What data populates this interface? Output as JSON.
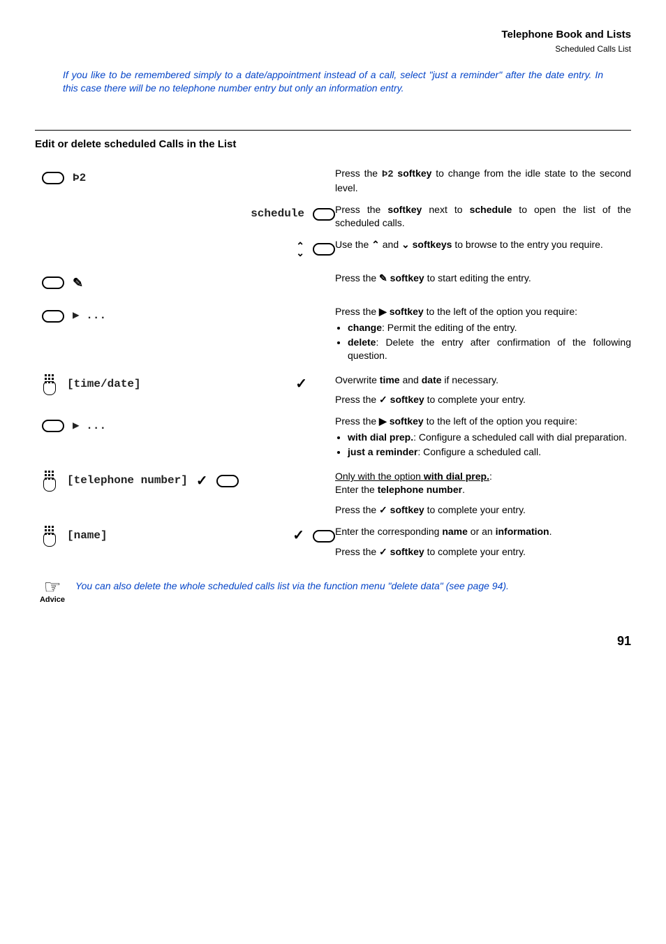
{
  "header": {
    "title": "Telephone Book and Lists",
    "subtitle": "Scheduled Calls List"
  },
  "intro": "If you like to be remembered simply to a date/appointment instead of a call, select \"just a reminder\" after the date entry. In this case there will be no telephone number entry but only an information entry.",
  "section_title": "Edit or delete scheduled Calls in the List",
  "steps": {
    "s1": {
      "lcd": "Þ2",
      "r_pre": "Press the ",
      "r_sym": "Þ2",
      "r_post1": " softkey",
      "r_post2": " to change from the idle state to the second level."
    },
    "s2": {
      "lcd": "schedule",
      "r1": "Press the ",
      "r2": "softkey",
      "r3": " next to ",
      "r4": "schedule",
      "r5": " to open the list of the scheduled calls."
    },
    "s3": {
      "r1": "Use the ",
      "r2": " and ",
      "r3": " softkeys",
      "r4": " to browse to the entry you require."
    },
    "s4": {
      "r1": "Press the ",
      "r2": " softkey",
      "r3": " to start editing the entry."
    },
    "s5": {
      "r1": "Press the ",
      "r_arrow": "▶",
      "r2": " softkey",
      "r3": " to the left of the option you require:",
      "li1a": "change",
      "li1b": ": Permit the editing of the entry.",
      "li2a": "delete",
      "li2b": ": Delete the entry after confirmation of the following question."
    },
    "s6": {
      "lcd": "[time/date]",
      "r1a": "Overwrite ",
      "r1b": "time",
      "r1c": " and ",
      "r1d": "date",
      "r1e": " if necessary.",
      "r2a": "Press the ",
      "r2b": " softkey",
      "r2c": " to complete your entry."
    },
    "s7": {
      "r1": "Press the ",
      "r_arrow": "▶",
      "r2": " softkey",
      "r3": " to the left of the option you require:",
      "li1a": "with dial prep.",
      "li1b": ": Configure a scheduled call with dial preparation.",
      "li2a": "just a reminder",
      "li2b": ": Configure a scheduled call."
    },
    "s8": {
      "lcd": "[telephone number]",
      "h1": "Only with the option ",
      "h2": "with dial prep.",
      "h3": ":",
      "r1a": "Enter the ",
      "r1b": "telephone number",
      "r1c": ".",
      "r2a": "Press the ",
      "r2b": " softkey",
      "r2c": " to complete your entry."
    },
    "s9": {
      "lcd": "[name]",
      "r1a": "Enter the corresponding ",
      "r1b": "name",
      "r1c": " or an ",
      "r1d": "information",
      "r1e": ".",
      "r2a": "Press the ",
      "r2b": " softkey",
      "r2c": " to complete your entry."
    }
  },
  "advice": {
    "label": "Advice",
    "t1": "You can also delete the whole scheduled calls list via the function menu \"delete data\" (see ",
    "link": "page 94",
    "t2": ")."
  },
  "page_number": "91"
}
